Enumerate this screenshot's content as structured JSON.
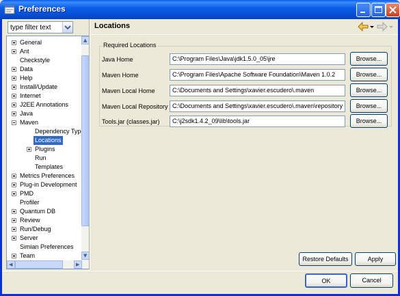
{
  "window": {
    "title": "Preferences"
  },
  "filter": {
    "placeholder": "type filter text"
  },
  "tree": {
    "items": [
      {
        "label": "General",
        "expander": "plus"
      },
      {
        "label": "Ant",
        "expander": "plus"
      },
      {
        "label": "Checkstyle",
        "expander": ""
      },
      {
        "label": "Data",
        "expander": "plus"
      },
      {
        "label": "Help",
        "expander": "plus"
      },
      {
        "label": "Install/Update",
        "expander": "plus"
      },
      {
        "label": "Internet",
        "expander": "plus"
      },
      {
        "label": "J2EE Annotations",
        "expander": "plus"
      },
      {
        "label": "Java",
        "expander": "plus"
      },
      {
        "label": "Maven",
        "expander": "minus"
      },
      {
        "label": "Dependency Type",
        "expander": "",
        "indent": 1
      },
      {
        "label": "Locations",
        "expander": "",
        "indent": 1,
        "selected": true
      },
      {
        "label": "Plugins",
        "expander": "plus",
        "indent": 1
      },
      {
        "label": "Run",
        "expander": "",
        "indent": 1
      },
      {
        "label": "Templates",
        "expander": "",
        "indent": 1
      },
      {
        "label": "Metrics Preferences",
        "expander": "plus"
      },
      {
        "label": "Plug-in Development",
        "expander": "plus"
      },
      {
        "label": "PMD",
        "expander": "plus"
      },
      {
        "label": "Profiler",
        "expander": ""
      },
      {
        "label": "Quantum DB",
        "expander": "plus"
      },
      {
        "label": "Review",
        "expander": "plus"
      },
      {
        "label": "Run/Debug",
        "expander": "plus"
      },
      {
        "label": "Server",
        "expander": "plus"
      },
      {
        "label": "Simian Preferences",
        "expander": ""
      },
      {
        "label": "Team",
        "expander": "plus"
      }
    ]
  },
  "page": {
    "title": "Locations",
    "group_label": "Required Locations",
    "rows": [
      {
        "label": "Java Home",
        "value": "C:\\Program Files\\Java\\jdk1.5.0_05\\jre",
        "button": "Browse..."
      },
      {
        "label": "Maven Home",
        "value": "C:\\Program Files\\Apache Software Foundation\\Maven 1.0.2",
        "button": "Browse..."
      },
      {
        "label": "Maven Local Home",
        "value": "C:\\Documents and Settings\\xavier.escudero\\.maven",
        "button": "Browse..."
      },
      {
        "label": "Maven Local Repository",
        "value": "C:\\Documents and Settings\\xavier.escudero\\.maven\\repository",
        "button": "Browse..."
      },
      {
        "label": "Tools.jar (classes.jar)",
        "value": "C:\\j2sdk1.4.2_09\\lib\\tools.jar",
        "button": "Browse..."
      }
    ],
    "restore_defaults": "Restore Defaults",
    "apply": "Apply"
  },
  "dialog": {
    "ok": "OK",
    "cancel": "Cancel"
  },
  "colors": {
    "selection": "#316ac5",
    "titlebar": "#0a5ce8",
    "face": "#ece9d8"
  }
}
